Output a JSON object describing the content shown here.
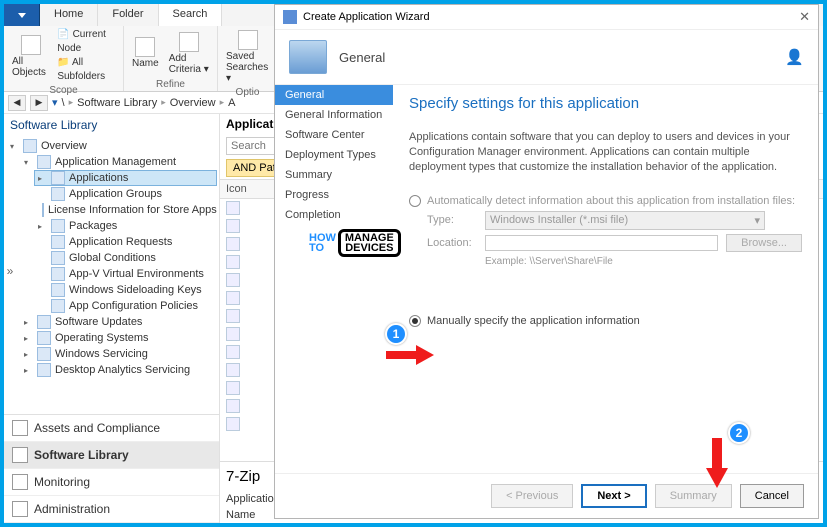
{
  "menubar": {
    "tabs": [
      "Home",
      "Folder",
      "Search"
    ],
    "active": 2
  },
  "ribbon": {
    "scope": {
      "name": "Scope",
      "items": [
        "All Objects"
      ],
      "list": [
        "Current Node",
        "All Subfolders"
      ]
    },
    "refine": {
      "name": "Refine",
      "items": [
        "Name",
        "Add Criteria ▾"
      ]
    },
    "options": {
      "name": "Optio",
      "items": [
        "Saved Searches ▾"
      ]
    }
  },
  "breadcrumb": [
    "\\",
    "Software Library",
    "Overview",
    "A"
  ],
  "nav": {
    "title": "Software Library",
    "tree": [
      {
        "t": "Overview",
        "exp": "▾",
        "lvl": 0
      },
      {
        "t": "Application Management",
        "exp": "▾",
        "lvl": 1
      },
      {
        "t": "Applications",
        "exp": "▸",
        "lvl": 2,
        "sel": true
      },
      {
        "t": "Application Groups",
        "lvl": 2
      },
      {
        "t": "License Information for Store Apps",
        "lvl": 2
      },
      {
        "t": "Packages",
        "exp": "▸",
        "lvl": 2
      },
      {
        "t": "Application Requests",
        "lvl": 2
      },
      {
        "t": "Global Conditions",
        "lvl": 2
      },
      {
        "t": "App-V Virtual Environments",
        "lvl": 2
      },
      {
        "t": "Windows Sideloading Keys",
        "lvl": 2
      },
      {
        "t": "App Configuration Policies",
        "lvl": 2
      },
      {
        "t": "Software Updates",
        "exp": "▸",
        "lvl": 1
      },
      {
        "t": "Operating Systems",
        "exp": "▸",
        "lvl": 1
      },
      {
        "t": "Windows Servicing",
        "exp": "▸",
        "lvl": 1
      },
      {
        "t": "Desktop Analytics Servicing",
        "exp": "▸",
        "lvl": 1
      }
    ],
    "workspaces": [
      {
        "t": "Assets and Compliance"
      },
      {
        "t": "Software Library",
        "sel": true
      },
      {
        "t": "Monitoring"
      },
      {
        "t": "Administration"
      }
    ]
  },
  "mid": {
    "header": "Applicatio",
    "search_ph": "Search",
    "filter": "AND Pat",
    "col": "Icon",
    "section": "7-Zip",
    "det1": "Applicatio",
    "det2": "Name"
  },
  "wizard": {
    "title": "Create Application Wizard",
    "page": "General",
    "steps": [
      "General",
      "General Information",
      "Software Center",
      "Deployment Types",
      "Summary",
      "Progress",
      "Completion"
    ],
    "content_title": "Specify settings for this application",
    "desc": "Applications contain software that you can deploy to users and devices in your Configuration Manager environment. Applications can contain multiple deployment types that customize the installation behavior of the application.",
    "opt_auto": "Automatically detect information about this application from installation files:",
    "type_lbl": "Type:",
    "type_val": "Windows Installer (*.msi file)",
    "loc_lbl": "Location:",
    "browse": "Browse...",
    "example": "Example: \\\\Server\\Share\\File",
    "opt_manual": "Manually specify the application information",
    "buttons": {
      "prev": "< Previous",
      "next": "Next >",
      "summary": "Summary",
      "cancel": "Cancel"
    }
  },
  "annotations": {
    "b1": "1",
    "b2": "2"
  },
  "logo": {
    "l1": "HOW",
    "l2": "TO",
    "l3": "MANAGE",
    "l4": "DEVICES"
  }
}
